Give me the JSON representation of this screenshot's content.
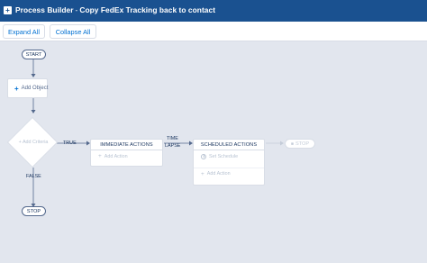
{
  "header": {
    "app_title": "Process Builder",
    "separator": "-",
    "process_name": "Copy FedEx Tracking back to contact",
    "icon": "process-builder-icon"
  },
  "toolbar": {
    "expand_label": "Expand All",
    "collapse_label": "Collapse All"
  },
  "canvas": {
    "start_label": "START",
    "add_object_label": "Add Object",
    "add_criteria_label": "Add Criteria",
    "true_label": "TRUE",
    "false_label": "FALSE",
    "stop_label": "STOP",
    "stop_ghost_label": "STOP",
    "time_lapse_label_1": "TIME",
    "time_lapse_label_2": "LAPSE",
    "immediate": {
      "header": "IMMEDIATE ACTIONS",
      "add_action": "Add Action"
    },
    "scheduled": {
      "header": "SCHEDULED ACTIONS",
      "set_schedule": "Set Schedule",
      "add_action": "Add Action"
    }
  },
  "colors": {
    "header_bg": "#1a5190",
    "canvas_bg": "#e2e6ee",
    "link_blue": "#0070d2",
    "connector": "#54698d"
  }
}
